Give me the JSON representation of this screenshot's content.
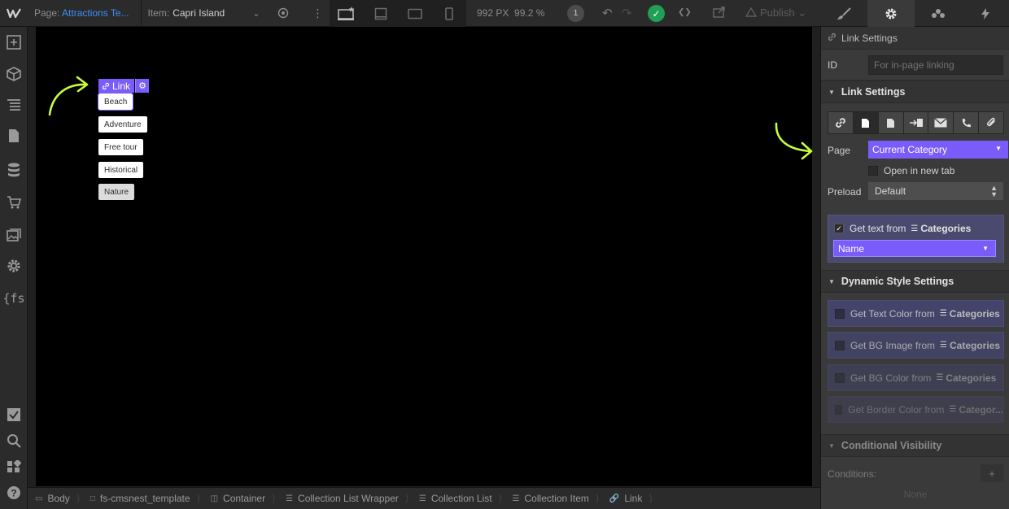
{
  "topbar": {
    "page_prefix": "Page:",
    "page_name": "Attractions Te...",
    "item_prefix": "Item:",
    "item_name": "Capri Island",
    "size": "992 PX",
    "zoom": "99.2 %",
    "badge": "1",
    "publish_label": "Publish"
  },
  "canvas": {
    "selected_label": "Link",
    "chips": [
      "Beach",
      "Adventure",
      "Free tour",
      "Historical",
      "Nature"
    ]
  },
  "breadcrumb": [
    "Body",
    "fs-cmsnest_template",
    "Container",
    "Collection List Wrapper",
    "Collection List",
    "Collection Item",
    "Link"
  ],
  "panel": {
    "header": "Link Settings",
    "id_label": "ID",
    "id_placeholder": "For in-page linking",
    "link_settings_title": "Link Settings",
    "page_label": "Page",
    "page_value": "Current Category",
    "open_new_tab": "Open in new tab",
    "preload_label": "Preload",
    "preload_value": "Default",
    "get_text_label": "Get text from",
    "get_text_source": "Categories",
    "field_value": "Name",
    "dynamic_title": "Dynamic Style Settings",
    "dynamic_items": [
      {
        "label": "Get Text Color from",
        "source": "Categories"
      },
      {
        "label": "Get BG Image from",
        "source": "Categories"
      },
      {
        "label": "Get BG Color from",
        "source": "Categories"
      },
      {
        "label": "Get Border Color from",
        "source": "Categor..."
      }
    ],
    "conditional_title": "Conditional Visibility",
    "conditions_label": "Conditions:",
    "conditions_none": "None"
  },
  "colors": {
    "accent": "#7a5cfa",
    "annotation_arrow": "#c6ff3d",
    "save_ok": "#1fa055"
  }
}
